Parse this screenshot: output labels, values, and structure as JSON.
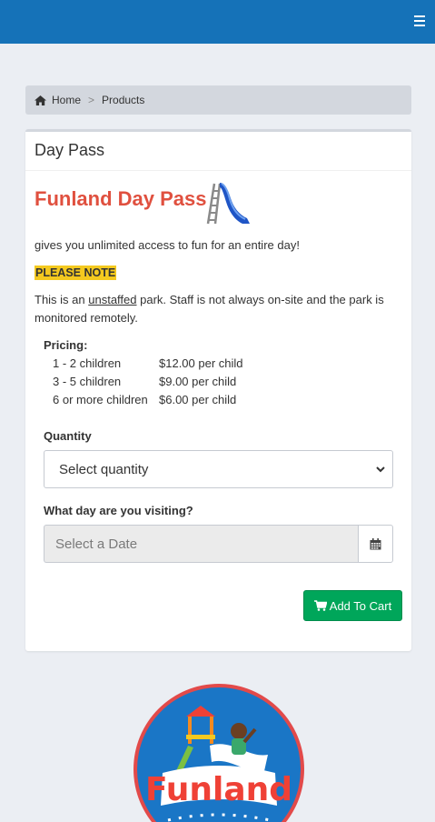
{
  "breadcrumb": {
    "home": "Home",
    "separator": ">",
    "current": "Products"
  },
  "panel": {
    "title": "Day Pass"
  },
  "product": {
    "heading": "Funland Day Pass",
    "intro": "gives you unlimited access to fun for an entire day!",
    "note": "PLEASE NOTE",
    "para_before": "This is an ",
    "para_underlined": "unstaffed",
    "para_after": " park. Staff is not always on-site and the park is monitored remotely."
  },
  "pricing": {
    "label": "Pricing:",
    "rows": [
      {
        "tier": "1 - 2 children",
        "price": "$12.00 per child"
      },
      {
        "tier": "3 - 5 children",
        "price": "$9.00 per child"
      },
      {
        "tier": "6 or more children",
        "price": "$6.00 per child"
      }
    ]
  },
  "quantity": {
    "label": "Quantity",
    "selected": "Select quantity"
  },
  "date": {
    "label": "What day are you visiting?",
    "placeholder": "Select a Date"
  },
  "cart": {
    "button_label": "Add To Cart"
  },
  "logo": {
    "text": "Funland"
  },
  "colors": {
    "topbar": "#1572b8",
    "heading": "#e0503f",
    "note_bg": "#f4c91f",
    "cart_button": "#00a65a"
  },
  "icons": {
    "menu": "bars-icon",
    "home": "home-icon",
    "calendar": "calendar-icon",
    "cart": "cart-icon",
    "slide": "slide-icon",
    "select": "chevron-down-icon"
  }
}
